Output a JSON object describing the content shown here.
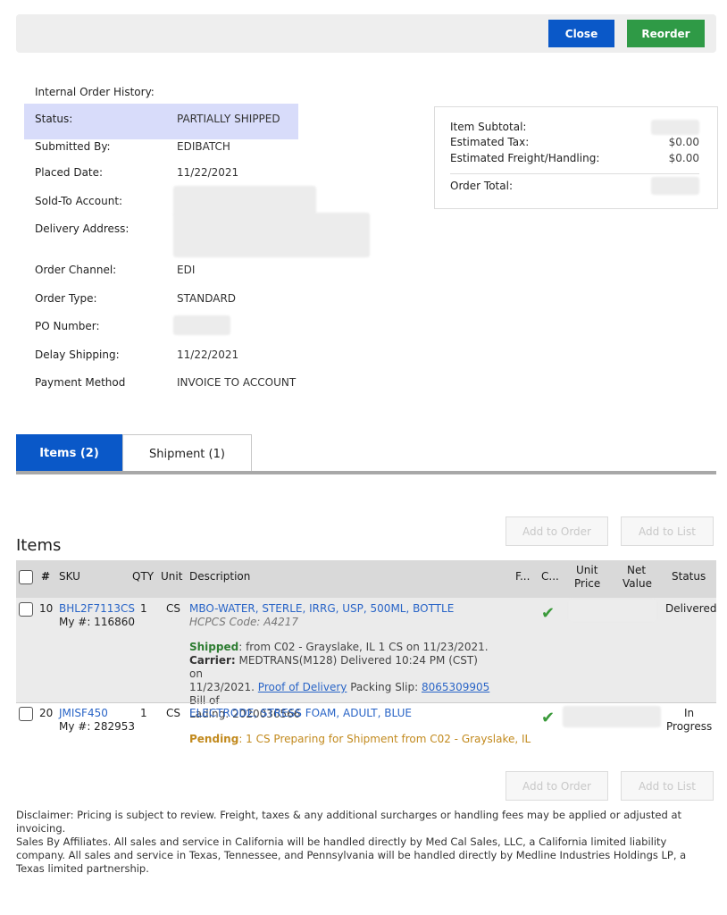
{
  "header": {
    "close_label": "Close",
    "reorder_label": "Reorder"
  },
  "order": {
    "history_title": "Internal Order History:",
    "fields": [
      {
        "label": "Status:",
        "value": "PARTIALLY SHIPPED"
      },
      {
        "label": "Submitted By:",
        "value": "EDIBATCH"
      },
      {
        "label": "Placed Date:",
        "value": "11/22/2021"
      },
      {
        "label": "Sold-To Account:",
        "value": ""
      },
      {
        "label": "Delivery Address:",
        "value": ""
      },
      {
        "label": "Order Channel:",
        "value": "EDI"
      },
      {
        "label": "Order Type:",
        "value": "STANDARD"
      },
      {
        "label": "PO Number:",
        "value": ""
      },
      {
        "label": "Delay Shipping:",
        "value": "11/22/2021"
      },
      {
        "label": "Payment Method",
        "value": "INVOICE TO ACCOUNT"
      }
    ]
  },
  "totals": {
    "subtotal_label": "Item Subtotal:",
    "tax_label": "Estimated Tax:",
    "tax_value": "$0.00",
    "freight_label": "Estimated Freight/Handling:",
    "freight_value": "$0.00",
    "total_label": "Order Total:"
  },
  "tabs": {
    "items": "Items (2)",
    "shipment": "Shipment (1)"
  },
  "items": {
    "title": "Items",
    "add_to_order": "Add to Order",
    "add_to_list": "Add to List",
    "columns": {
      "num": "#",
      "sku": "SKU",
      "qty": "QTY",
      "unit": "Unit",
      "description": "Description",
      "f": "F...",
      "c": "C...",
      "unit_price_1": "Unit",
      "unit_price_2": "Price",
      "net_value_1": "Net",
      "net_value_2": "Value",
      "status": "Status"
    },
    "rows": [
      {
        "num": "10",
        "sku": "BHL2F7113CS",
        "my_num": "My #: 116860",
        "qty": "1",
        "unit": "CS",
        "description": "MBO-WATER, STERLE, IRRG, USP, 500ML, BOTTLE",
        "hcpcs": "HCPCS Code: A4217",
        "status": "Delivered",
        "shipped_label": "Shipped",
        "shipped_text": ": from C02 - Grayslake, IL 1 CS on 11/23/2021.",
        "carrier_label": "Carrier:",
        "carrier_text_1": " MEDTRANS(M128) Delivered 10:24 PM (CST) on",
        "carrier_text_2": "11/23/2021. ",
        "pod_link": " Proof of Delivery",
        "packing_label": " Packing Slip: ",
        "packing_link": "8065309905",
        "bill_text_1": " Bill of",
        "bill_text_2": "Lading: 2020036566"
      },
      {
        "num": "20",
        "sku": "JMISF450",
        "my_num": "My #: 282953",
        "qty": "1",
        "unit": "CS",
        "description": "ELECTRODE, STRESS FOAM, ADULT, BLUE",
        "status_1": "In",
        "status_2": "Progress",
        "pending_label": "Pending",
        "pending_text": ": 1 CS Preparing for Shipment from C02 - Grayslake, IL"
      }
    ]
  },
  "disclaimer": "Disclaimer: Pricing is subject to review. Freight, taxes & any additional surcharges or handling fees may be applied or adjusted at invoicing.",
  "affiliates": "Sales By Affiliates. All sales and service in California will be handled directly by Med Cal Sales, LLC, a California limited liability company. All sales and service in Texas, Tennessee, and Pennsylvania will be handled directly by Medline Industries Holdings LP, a Texas limited partnership.",
  "colors": {
    "primary": "#0a58c8",
    "success": "#2f9a46",
    "highlight": "#d8dcfa",
    "pending": "#c28a1e",
    "shipped": "#2e7d32"
  }
}
